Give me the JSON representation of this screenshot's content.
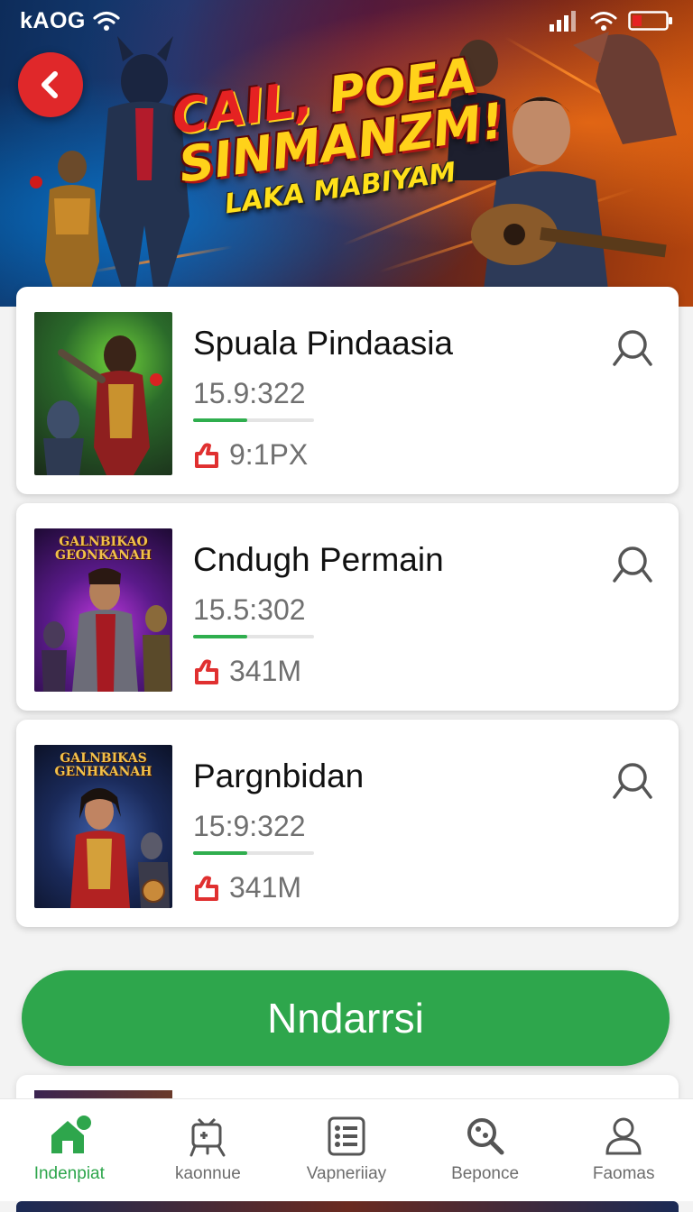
{
  "status_bar": {
    "carrier": "kAOG",
    "icons": [
      "wifi-icon",
      "signal-icon",
      "wifi-icon",
      "battery-icon"
    ]
  },
  "hero": {
    "title_line1_red": "CAIL,",
    "title_line1_yellow": " POEA",
    "title_line2": "SINMANZM!",
    "title_line3": "LAKA MABIYAM",
    "back_icon": "chevron-left-icon"
  },
  "items": [
    {
      "title": "Spuala Pindaasia",
      "time": "15.9:322",
      "progress": 0.45,
      "stat": "9:1PX",
      "thumb_caption": ""
    },
    {
      "title": "Cndugh Permain",
      "time": "15.5:302",
      "progress": 0.45,
      "stat": "341M",
      "thumb_caption": "GALNBIKAO GEONKANAH"
    },
    {
      "title": "Pargnbidan",
      "time": "15:9:322",
      "progress": 0.45,
      "stat": "341M",
      "thumb_caption": "GALNBIKAS GENHKANAH"
    }
  ],
  "cta": {
    "label": "Nndarrsi"
  },
  "nav": [
    {
      "label": "Indenpiat",
      "icon": "home-icon",
      "active": true
    },
    {
      "label": "kaonnue",
      "icon": "gamepad-icon",
      "active": false
    },
    {
      "label": "Vapneriiay",
      "icon": "list-icon",
      "active": false
    },
    {
      "label": "Beponce",
      "icon": "search-icon",
      "active": false
    },
    {
      "label": "Faomas",
      "icon": "user-icon",
      "active": false
    }
  ],
  "colors": {
    "accent_green": "#2ea64c",
    "back_button_red": "#e0282a",
    "stat_icon_red": "#e03030"
  }
}
